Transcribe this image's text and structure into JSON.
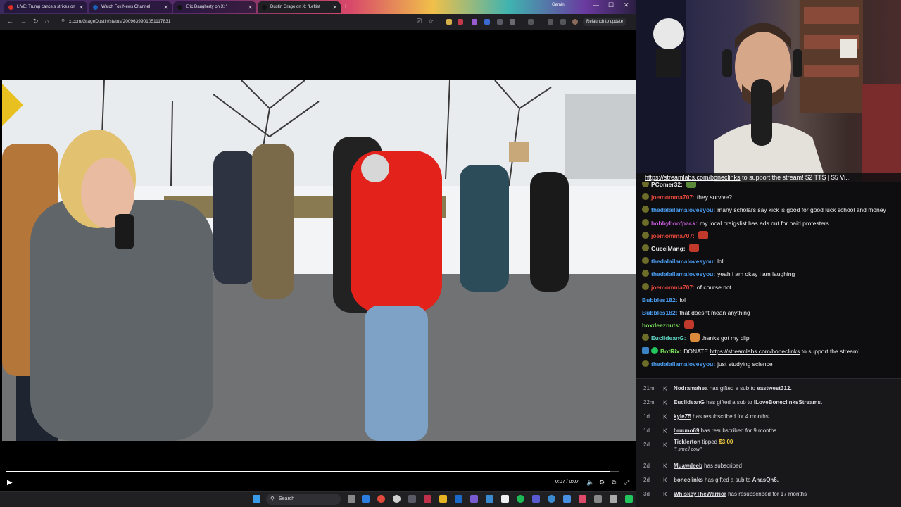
{
  "browser": {
    "tabs": [
      {
        "title": "LIVE: Trump cancels strikes on",
        "fav": "#d93025"
      },
      {
        "title": "Watch Fox News Channel",
        "fav": "#1a5fb4"
      },
      {
        "title": "Eric Daugherty on X: \"",
        "fav": "#111111"
      },
      {
        "title": "Dustin Grage on X: \"Leftist",
        "fav": "#111111"
      }
    ],
    "new_tab_icon": "+",
    "profile_label": "Gemini",
    "url": "x.com/GrageDustin/status/2009639901051117831",
    "relaunch_label": "Relaunch to update"
  },
  "video": {
    "time": "0:07 / 0:07",
    "progress": 0.985
  },
  "donate_banner": {
    "link": "https://streamlabs.com/boneclinks",
    "text": " to support the stream! $2 TTS | $5 Vi..."
  },
  "chat": [
    {
      "user": "PComer32:",
      "color": "#e6e6e6",
      "text": "",
      "emote": "#5a8a3a",
      "partial": true
    },
    {
      "user": "joemomma707:",
      "color": "#e0463a",
      "text": "they survive?"
    },
    {
      "user": "thedalailamalovesyou:",
      "color": "#4a9cf0",
      "text": "many scholars say kick is good for good luck school and money"
    },
    {
      "user": "bobbyboofpack:",
      "color": "#c45bd8",
      "text": "my local craigslist has ads out for paid protesters"
    },
    {
      "user": "joemomma707:",
      "color": "#e0463a",
      "text": "",
      "emote": "#c0392b"
    },
    {
      "user": "GucciMang:",
      "color": "#e8e8e8",
      "text": "",
      "emote": "#c0392b"
    },
    {
      "user": "thedalailamalovesyou:",
      "color": "#4a9cf0",
      "text": "lol"
    },
    {
      "user": "thedalailamalovesyou:",
      "color": "#4a9cf0",
      "text": "yeah i am okay i am laughing"
    },
    {
      "user": "joemomma707:",
      "color": "#e0463a",
      "text": "of course not"
    },
    {
      "user": "Bubbles182:",
      "color": "#4a9cf0",
      "text": "lol",
      "noicon": true
    },
    {
      "user": "Bubbles182:",
      "color": "#4a9cf0",
      "text": "that doesnt mean anything",
      "noicon": true
    },
    {
      "user": "boxdeeznuts:",
      "color": "#7be05a",
      "text": "",
      "emote": "#c0392b",
      "noicon": true
    },
    {
      "user": "EuclideanG:",
      "color": "#5fd0c0",
      "text": "thanks got my clip",
      "emote_before": "#d98a3a"
    },
    {
      "user": "BotRix:",
      "color": "#7be05a",
      "text": "DONATE ",
      "link": "https://streamlabs.com/boneclinks",
      "after": " to support the stream!",
      "bot": true
    },
    {
      "user": "thedalailamalovesyou:",
      "color": "#4a9cf0",
      "text": "just studying science"
    }
  ],
  "feed": [
    {
      "time": "21m",
      "name": "Nodramahea",
      "underline": false,
      "text": " has gifted a sub to ",
      "target": "eastwest312."
    },
    {
      "time": "22m",
      "name": "EuclideanG",
      "underline": false,
      "text": " has gifted a sub to ",
      "target": "ILoveBoneclinksStreams."
    },
    {
      "time": "1d",
      "name": "kyleZ5",
      "underline": true,
      "text": " has resubscribed for 4 months",
      "target": ""
    },
    {
      "time": "1d",
      "name": "bruuno69",
      "underline": true,
      "text": " has resubscribed for 9 months",
      "target": ""
    },
    {
      "time": "2d",
      "name": "Ticklerton",
      "underline": false,
      "text": " tipped ",
      "amount": "$3.00",
      "quote": "\"I smell cow\""
    },
    {
      "time": "2d",
      "name": "Muawdeeb",
      "underline": true,
      "text": " has subscribed",
      "target": ""
    },
    {
      "time": "2d",
      "name": "boneclinks",
      "underline": false,
      "text": " has gifted a sub to ",
      "target": "AnasQh6."
    },
    {
      "time": "3d",
      "name": "WhiskeyTheWarrior",
      "underline": true,
      "text": " has resubscribed for 17 months",
      "target": ""
    }
  ],
  "taskbar": {
    "search_label": "Search"
  }
}
